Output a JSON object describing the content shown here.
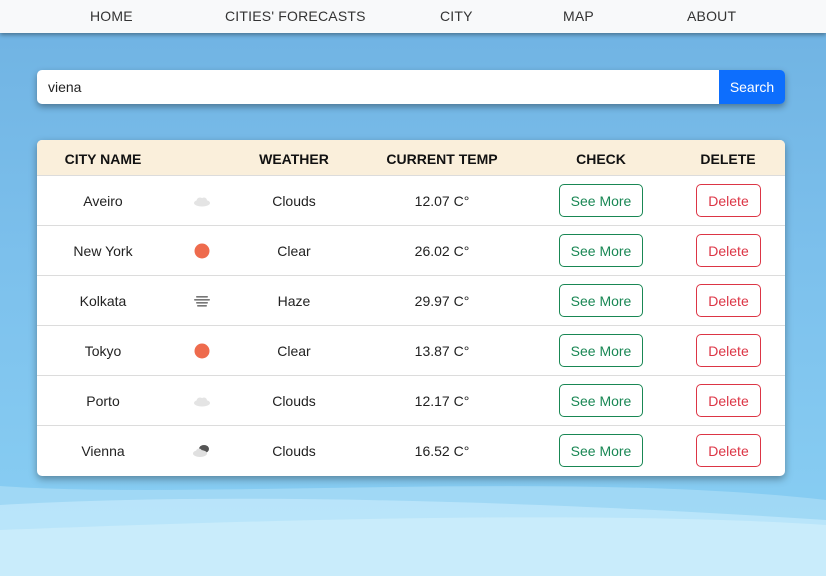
{
  "nav": {
    "items": [
      "HOME",
      "CITIES' FORECASTS",
      "CITY",
      "MAP",
      "ABOUT"
    ]
  },
  "search": {
    "value": "viena",
    "button_label": "Search"
  },
  "table": {
    "headers": {
      "city": "CITY NAME",
      "weather": "WEATHER",
      "temp": "CURRENT TEMP",
      "check": "CHECK",
      "delete": "DELETE"
    },
    "rows": [
      {
        "city": "Aveiro",
        "icon": "cloud-icon",
        "weather": "Clouds",
        "temp": "12.07 C°",
        "check": "See More",
        "delete": "Delete"
      },
      {
        "city": "New York",
        "icon": "sun-icon",
        "weather": "Clear",
        "temp": "26.02 C°",
        "check": "See More",
        "delete": "Delete"
      },
      {
        "city": "Kolkata",
        "icon": "haze-icon",
        "weather": "Haze",
        "temp": "29.97 C°",
        "check": "See More",
        "delete": "Delete"
      },
      {
        "city": "Tokyo",
        "icon": "sun-icon",
        "weather": "Clear",
        "temp": "13.87 C°",
        "check": "See More",
        "delete": "Delete"
      },
      {
        "city": "Porto",
        "icon": "cloud-icon",
        "weather": "Clouds",
        "temp": "12.17 C°",
        "check": "See More",
        "delete": "Delete"
      },
      {
        "city": "Vienna",
        "icon": "broken-clouds-icon",
        "weather": "Clouds",
        "temp": "16.52 C°",
        "check": "See More",
        "delete": "Delete"
      }
    ]
  },
  "colors": {
    "nav_bg": "#f8f9fa",
    "header_bg": "#faefdb",
    "primary": "#0d6efd",
    "success": "#198754",
    "danger": "#dc3545",
    "sun": "#ee6b4d",
    "page_bg": "#7cc0ec"
  }
}
